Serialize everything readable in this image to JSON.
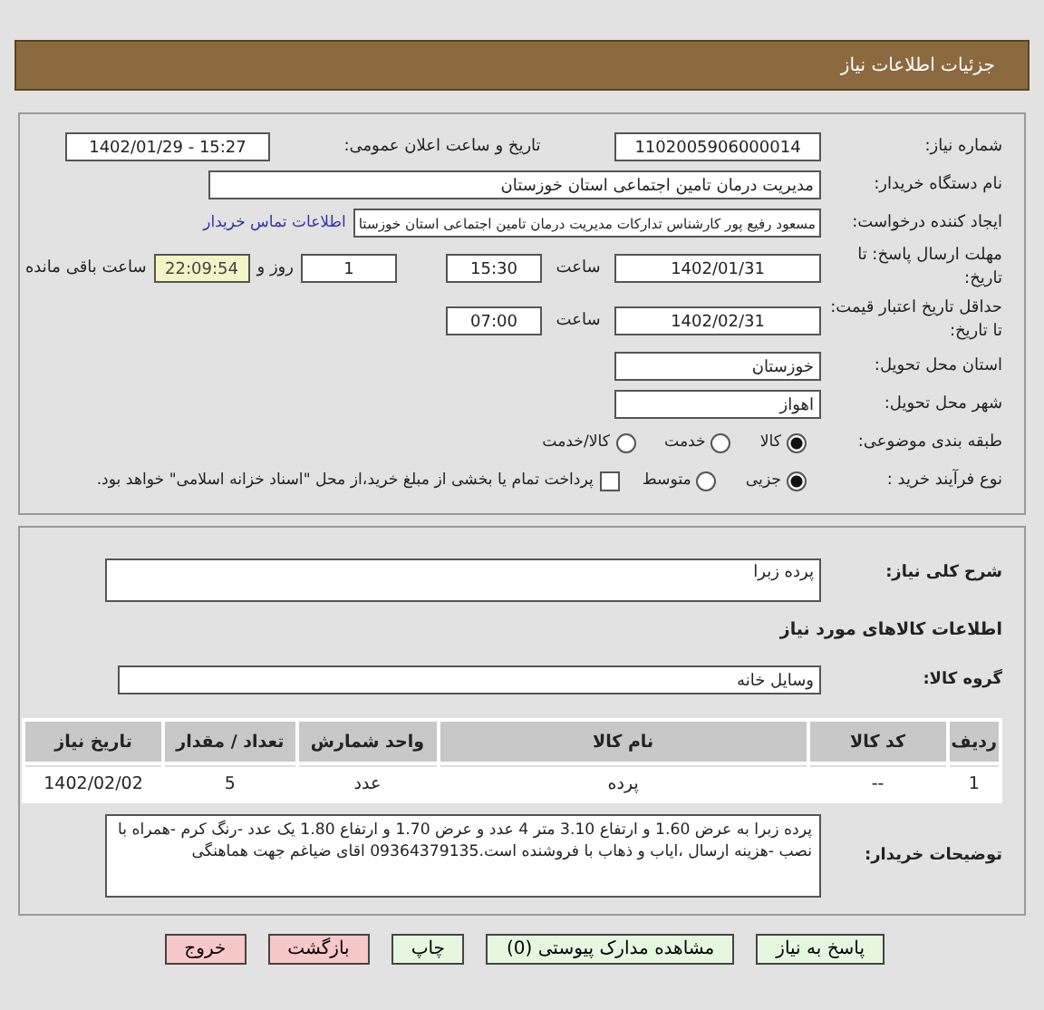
{
  "header": {
    "title": "جزئیات اطلاعات نیاز"
  },
  "need_number": {
    "label": "شماره نیاز:",
    "value": "1102005906000014"
  },
  "announce": {
    "label": "تاریخ و ساعت اعلان عمومی:",
    "value": "1402/01/29 - 15:27"
  },
  "buyer": {
    "label": "نام دستگاه خریدار:",
    "value": "مدیریت درمان تامین اجتماعی استان خوزستان"
  },
  "requester": {
    "label": "ایجاد کننده درخواست:",
    "value": "مسعود رفیع پور کارشناس تدارکات مدیریت درمان تامین اجتماعی استان خوزستا",
    "link": "اطلاعات تماس خریدار"
  },
  "reply_deadline": {
    "label": "مهلت ارسال پاسخ: تا تاریخ:",
    "date": "1402/01/31",
    "time_label": "ساعت",
    "time": "15:30",
    "days": "1",
    "days_label": "روز و",
    "remaining": "22:09:54",
    "remaining_label": "ساعت باقی مانده"
  },
  "price_validity": {
    "label": "حداقل تاریخ اعتبار قیمت: تا تاریخ:",
    "date": "1402/02/31",
    "time_label": "ساعت",
    "time": "07:00"
  },
  "province": {
    "label": "استان محل تحویل:",
    "value": "خوزستان"
  },
  "city": {
    "label": "شهر محل تحویل:",
    "value": "اهواز"
  },
  "category": {
    "label": "طبقه بندی موضوعی:",
    "options": [
      {
        "label": "کالا",
        "selected": true
      },
      {
        "label": "خدمت",
        "selected": false
      },
      {
        "label": "کالا/خدمت",
        "selected": false
      }
    ]
  },
  "process": {
    "label": "نوع فرآیند خرید :",
    "options": [
      {
        "label": "جزیی",
        "selected": true
      },
      {
        "label": "متوسط",
        "selected": false
      }
    ],
    "payment_note": {
      "label": "پرداخت تمام یا بخشی از مبلغ خرید،از محل \"اسناد خزانه اسلامی\" خواهد بود.",
      "checked": false
    }
  },
  "description": {
    "label": "شرح کلی نیاز:",
    "value": "پرده زبرا"
  },
  "goods_title": "اطلاعات کالاهای مورد نیاز",
  "goods_group": {
    "label": "گروه کالا:",
    "value": "وسایل خانه"
  },
  "table": {
    "columns": [
      "ردیف",
      "کد کالا",
      "نام کالا",
      "واحد شمارش",
      "تعداد / مقدار",
      "تاریخ نیاز"
    ],
    "rows": [
      [
        "1",
        "--",
        "پرده",
        "عدد",
        "5",
        "1402/02/02"
      ]
    ]
  },
  "buyer_notes": {
    "label": "توضیحات خریدار:",
    "value": "پرده زبرا به عرض 1.60 و ارتفاع 3.10 متر 4 عدد و عرض 1.70 و ارتفاع 1.80 یک عدد -رنگ کرم -همراه با نصب -هزینه ارسال ،ایاب و ذهاب با فروشنده است.09364379135 اقای ضیاغم جهت هماهنگی"
  },
  "buttons": [
    {
      "label": "پاسخ به نیاز",
      "kind": "green"
    },
    {
      "label": "مشاهده مدارک پیوستی (0)",
      "kind": "green"
    },
    {
      "label": "چاپ",
      "kind": "green"
    },
    {
      "label": "بازگشت",
      "kind": "red"
    },
    {
      "label": "خروج",
      "kind": "red"
    }
  ]
}
